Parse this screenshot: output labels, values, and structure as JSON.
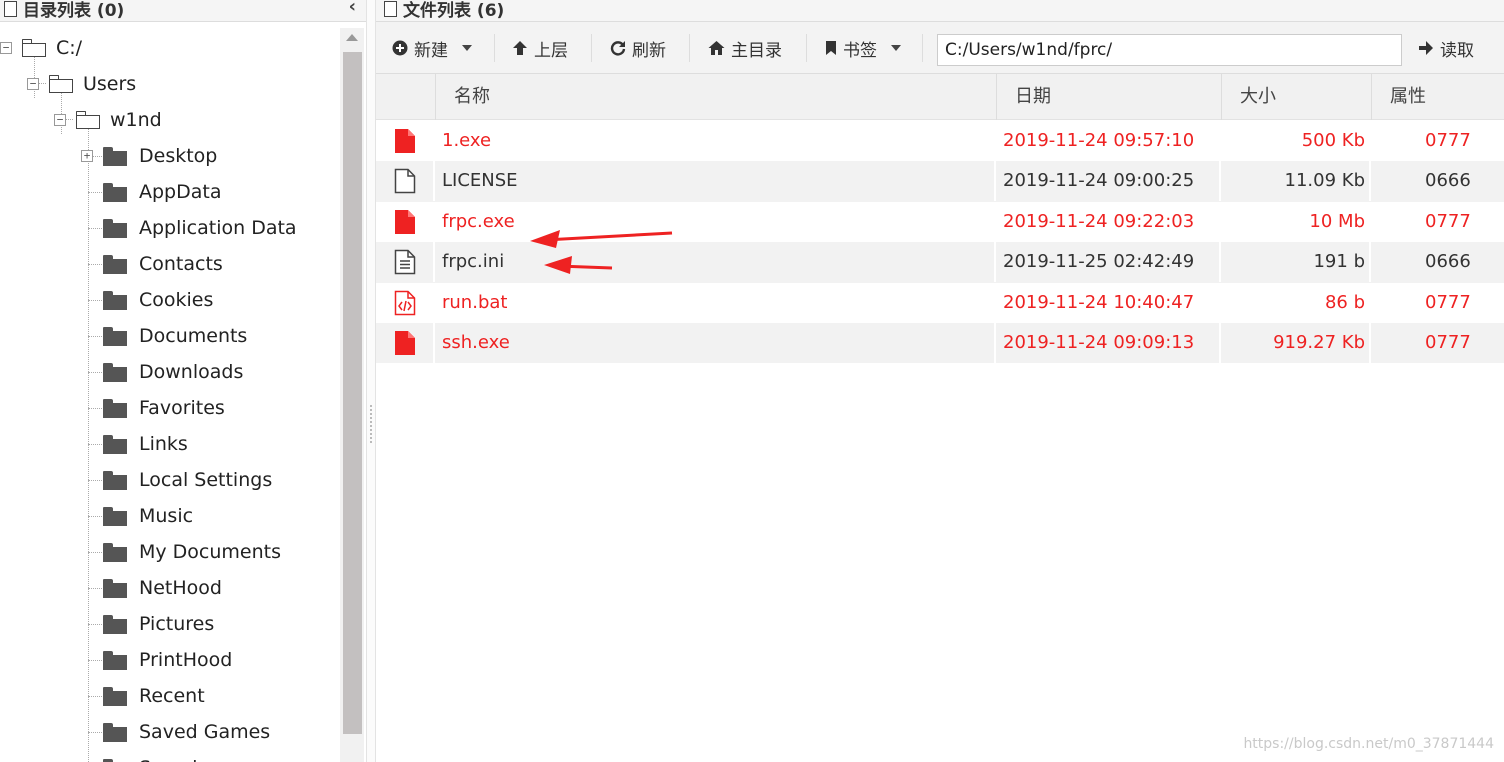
{
  "left_panel": {
    "title": "目录列表 (0)",
    "collapse_icon": "chevron-left-icon",
    "tree": {
      "root": "C:/",
      "users": "Users",
      "user": "w1nd",
      "folders": [
        "Desktop",
        "AppData",
        "Application Data",
        "Contacts",
        "Cookies",
        "Documents",
        "Downloads",
        "Favorites",
        "Links",
        "Local Settings",
        "Music",
        "My Documents",
        "NetHood",
        "Pictures",
        "PrintHood",
        "Recent",
        "Saved Games",
        "Searches"
      ]
    }
  },
  "right_panel": {
    "title": "文件列表 (6)",
    "toolbar": {
      "new_label": "新建",
      "up_label": "上层",
      "refresh_label": "刷新",
      "home_label": "主目录",
      "bookmark_label": "书签",
      "path_value": "C:/Users/w1nd/fprc/",
      "read_label": "读取"
    },
    "columns": {
      "name": "名称",
      "date": "日期",
      "size": "大小",
      "attr": "属性"
    },
    "files": [
      {
        "name": "1.exe",
        "date": "2019-11-24 09:57:10",
        "size": "500 Kb",
        "attr": "0777",
        "icon": "executable-file-icon",
        "highlight": true
      },
      {
        "name": "LICENSE",
        "date": "2019-11-24 09:00:25",
        "size": "11.09 Kb",
        "attr": "0666",
        "icon": "blank-file-icon",
        "highlight": false
      },
      {
        "name": "frpc.exe",
        "date": "2019-11-24 09:22:03",
        "size": "10 Mb",
        "attr": "0777",
        "icon": "executable-file-icon",
        "highlight": true
      },
      {
        "name": "frpc.ini",
        "date": "2019-11-25 02:42:49",
        "size": "191 b",
        "attr": "0666",
        "icon": "text-file-icon",
        "highlight": false
      },
      {
        "name": "run.bat",
        "date": "2019-11-24 10:40:47",
        "size": "86 b",
        "attr": "0777",
        "icon": "code-file-icon",
        "highlight": true
      },
      {
        "name": "ssh.exe",
        "date": "2019-11-24 09:09:13",
        "size": "919.27 Kb",
        "attr": "0777",
        "icon": "executable-file-icon",
        "highlight": true
      }
    ]
  },
  "annotation_color": "#ee2222",
  "watermark": "https://blog.csdn.net/m0_37871444"
}
